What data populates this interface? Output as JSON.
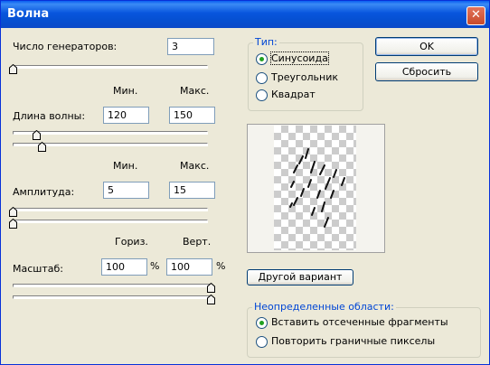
{
  "window": {
    "title": "Волна",
    "close_glyph": "✕"
  },
  "generators": {
    "label": "Число генераторов:",
    "value": "3",
    "slider_fraction": 0.0
  },
  "wavelength": {
    "min_header": "Мин.",
    "max_header": "Макс.",
    "label": "Длина волны:",
    "min_value": "120",
    "max_value": "150",
    "min_slider_fraction": 0.12,
    "max_slider_fraction": 0.15
  },
  "amplitude": {
    "min_header": "Мин.",
    "max_header": "Макс.",
    "label": "Амплитуда:",
    "min_value": "5",
    "max_value": "15",
    "min_slider_fraction": 0.0,
    "max_slider_fraction": 0.0
  },
  "scale": {
    "horiz_header": "Гориз.",
    "vert_header": "Верт.",
    "label": "Масштаб:",
    "horiz_value": "100",
    "vert_value": "100",
    "unit": "%",
    "horiz_slider_fraction": 1.0,
    "vert_slider_fraction": 1.0
  },
  "type_group": {
    "title": "Тип:",
    "options": [
      {
        "label": "Синусоида",
        "selected": true
      },
      {
        "label": "Треугольник",
        "selected": false
      },
      {
        "label": "Квадрат",
        "selected": false
      }
    ]
  },
  "buttons": {
    "ok": "OK",
    "reset": "Сбросить",
    "randomize": "Другой вариант"
  },
  "undefined_areas": {
    "title": "Неопределенные области:",
    "options": [
      {
        "label": "Вставить отсеченные фрагменты",
        "selected": true
      },
      {
        "label": "Повторить граничные пикселы",
        "selected": false
      }
    ]
  },
  "colors": {
    "titlebar": "#0A5FF0",
    "dialog_bg": "#ECE9D8",
    "group_title": "#0046D5",
    "radio_dot": "#21A121"
  }
}
